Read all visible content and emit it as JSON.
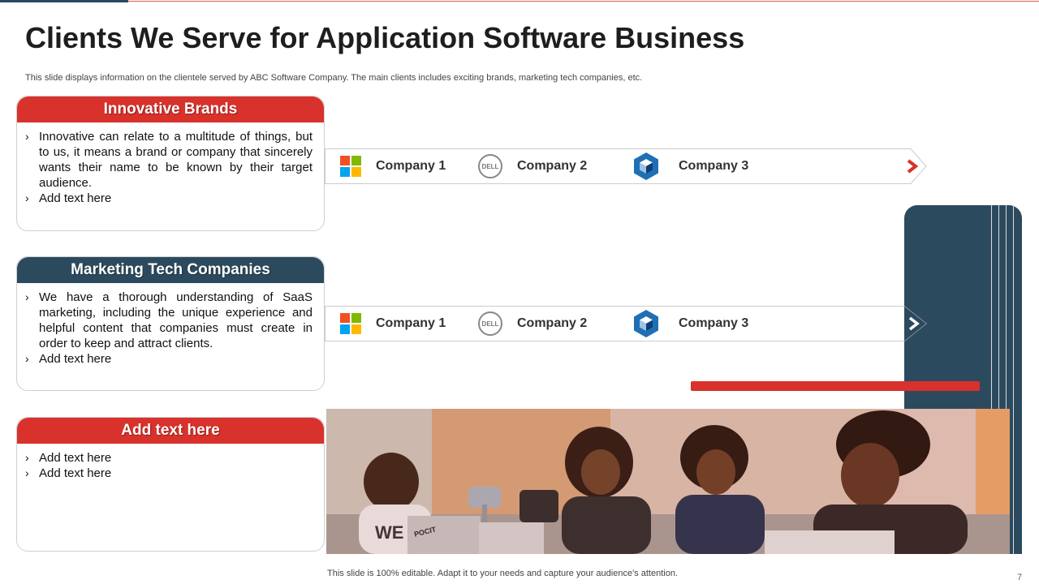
{
  "title": "Clients We Serve for Application Software Business",
  "subtitle": "This slide displays information on the clientele served by ABC Software Company. The main clients includes exciting brands, marketing tech companies, etc.",
  "cards": [
    {
      "heading": "Innovative Brands",
      "bullets": [
        "Innovative  can relate to a multitude of things, but to us, it means a brand or company that sincerely wants their name to be known by their target audience.",
        "Add text here"
      ]
    },
    {
      "heading": "Marketing Tech Companies",
      "bullets": [
        "We have a thorough understanding of SaaS marketing, including the unique experience and helpful content that companies must create in order to keep and attract clients.",
        "Add text here"
      ]
    },
    {
      "heading": "Add text here",
      "bullets": [
        "Add text here",
        "Add text here"
      ]
    }
  ],
  "rows": [
    {
      "companies": [
        "Company 1",
        "Company 2",
        "Company 3"
      ]
    },
    {
      "companies": [
        "Company 1",
        "Company 2",
        "Company 3"
      ]
    }
  ],
  "icons": {
    "logo_1": "microsoft-logo-icon",
    "logo_2": "dell-logo-icon",
    "logo_3": "cube-logo-icon",
    "row_1_arrow": "chevron-right-icon",
    "row_2_arrow": "chevron-right-icon"
  },
  "logo_2_text": "DELL",
  "photo_print_text": [
    "WE",
    "POCIT"
  ],
  "footer": "This slide is 100% editable. Adapt it to your needs and capture your audience's attention.",
  "page_number": "7",
  "colors": {
    "accent_red": "#d9312b",
    "navy": "#2c4a5e",
    "ms_red": "#f25022",
    "ms_green": "#7fba00",
    "ms_blue": "#00a4ef",
    "ms_yellow": "#ffb900",
    "cube_blue": "#1f6fb5"
  }
}
